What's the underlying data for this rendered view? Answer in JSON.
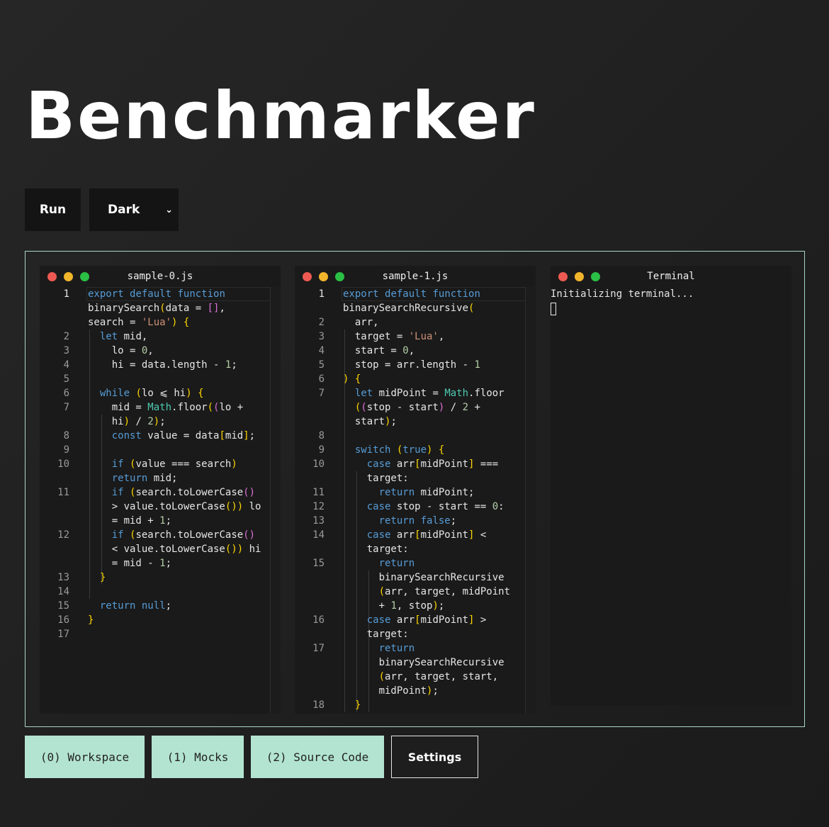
{
  "app": {
    "title": "Benchmarker"
  },
  "controls": {
    "run_label": "Run",
    "theme_value": "Dark"
  },
  "editors": [
    {
      "filename": "sample-0.js",
      "lines": [
        {
          "n": "1",
          "t": "export default function"
        },
        {
          "n": "",
          "t": "binarySearch(data = [],"
        },
        {
          "n": "",
          "t": "search = 'Lua') {"
        },
        {
          "n": "2",
          "t": "  let mid,"
        },
        {
          "n": "3",
          "t": "    lo = 0,"
        },
        {
          "n": "4",
          "t": "    hi = data.length - 1;"
        },
        {
          "n": "5",
          "t": ""
        },
        {
          "n": "6",
          "t": "  while (lo ⩽ hi) {"
        },
        {
          "n": "7",
          "t": "    mid = Math.floor((lo +"
        },
        {
          "n": "",
          "t": "    hi) / 2);"
        },
        {
          "n": "8",
          "t": "    const value = data[mid];"
        },
        {
          "n": "9",
          "t": ""
        },
        {
          "n": "10",
          "t": "    if (value === search)"
        },
        {
          "n": "",
          "t": "    return mid;"
        },
        {
          "n": "11",
          "t": "    if (search.toLowerCase()"
        },
        {
          "n": "",
          "t": "    > value.toLowerCase()) lo"
        },
        {
          "n": "",
          "t": "    = mid + 1;"
        },
        {
          "n": "12",
          "t": "    if (search.toLowerCase()"
        },
        {
          "n": "",
          "t": "    < value.toLowerCase()) hi"
        },
        {
          "n": "",
          "t": "    = mid - 1;"
        },
        {
          "n": "13",
          "t": "  }"
        },
        {
          "n": "14",
          "t": ""
        },
        {
          "n": "15",
          "t": "  return null;"
        },
        {
          "n": "16",
          "t": "}"
        },
        {
          "n": "17",
          "t": ""
        }
      ]
    },
    {
      "filename": "sample-1.js",
      "lines": [
        {
          "n": "1",
          "t": "export default function"
        },
        {
          "n": "",
          "t": "binarySearchRecursive("
        },
        {
          "n": "2",
          "t": "  arr,"
        },
        {
          "n": "3",
          "t": "  target = 'Lua',"
        },
        {
          "n": "4",
          "t": "  start = 0,"
        },
        {
          "n": "5",
          "t": "  stop = arr.length - 1"
        },
        {
          "n": "6",
          "t": ") {"
        },
        {
          "n": "7",
          "t": "  let midPoint = Math.floor"
        },
        {
          "n": "",
          "t": "  ((stop - start) / 2 +"
        },
        {
          "n": "",
          "t": "  start);"
        },
        {
          "n": "8",
          "t": ""
        },
        {
          "n": "9",
          "t": "  switch (true) {"
        },
        {
          "n": "10",
          "t": "    case arr[midPoint] ==="
        },
        {
          "n": "",
          "t": "    target:"
        },
        {
          "n": "11",
          "t": "      return midPoint;"
        },
        {
          "n": "12",
          "t": "    case stop - start == 0:"
        },
        {
          "n": "13",
          "t": "      return false;"
        },
        {
          "n": "14",
          "t": "    case arr[midPoint] <"
        },
        {
          "n": "",
          "t": "    target:"
        },
        {
          "n": "15",
          "t": "      return"
        },
        {
          "n": "",
          "t": "      binarySearchRecursive"
        },
        {
          "n": "",
          "t": "      (arr, target, midPoint"
        },
        {
          "n": "",
          "t": "      + 1, stop);"
        },
        {
          "n": "16",
          "t": "    case arr[midPoint] >"
        },
        {
          "n": "",
          "t": "    target:"
        },
        {
          "n": "17",
          "t": "      return"
        },
        {
          "n": "",
          "t": "      binarySearchRecursive"
        },
        {
          "n": "",
          "t": "      (arr, target, start,"
        },
        {
          "n": "",
          "t": "      midPoint);"
        },
        {
          "n": "18",
          "t": "  }"
        }
      ]
    }
  ],
  "terminal": {
    "title": "Terminal",
    "output": "Initializing terminal..."
  },
  "tabs": [
    {
      "label": "(0) Workspace"
    },
    {
      "label": "(1) Mocks"
    },
    {
      "label": "(2) Source Code"
    },
    {
      "label": "Settings"
    }
  ],
  "colors": {
    "keyword": "#569cd6",
    "control": "#c586c0",
    "string": "#ce9178",
    "number": "#b5cea8",
    "type": "#4ec9b0",
    "bracket_yellow": "#ffd700",
    "bracket_pink": "#da70d6",
    "bracket_blue": "#179fff",
    "border_mint": "#a9d6c4",
    "tab_mint": "#b3e4d2"
  }
}
